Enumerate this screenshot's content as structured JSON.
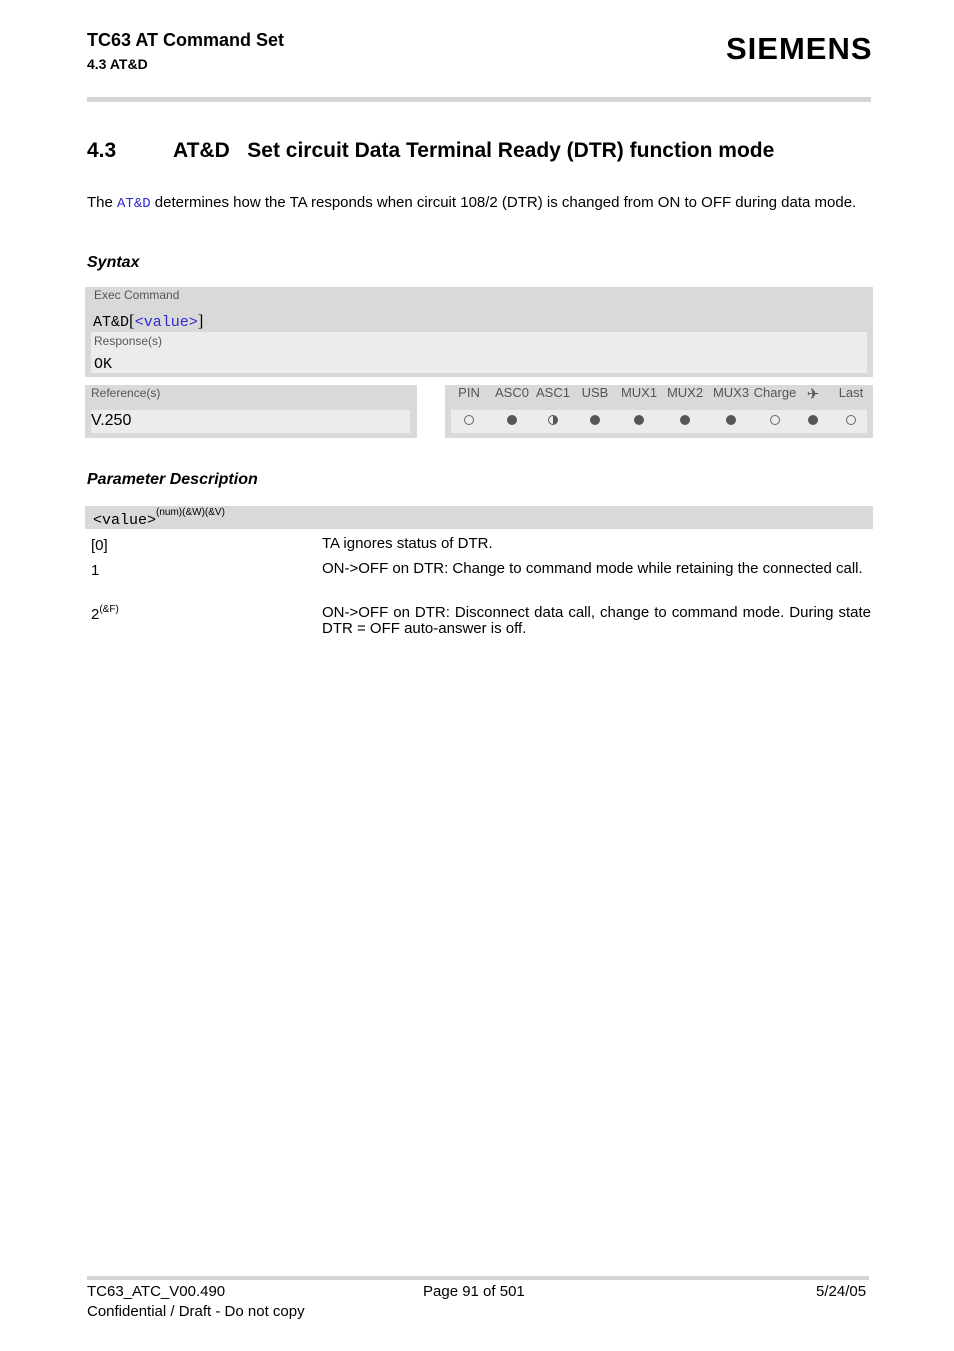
{
  "header": {
    "doc_title": "TC63 AT Command Set",
    "section_ref": "4.3 AT&D",
    "logo": "SIEMENS"
  },
  "section": {
    "number": "4.3",
    "title": "AT&D   Set circuit Data Terminal Ready (DTR) function mode"
  },
  "intro": {
    "pre": "The ",
    "command": "AT&D",
    "post": " determines how the TA responds when circuit 108/2 (DTR) is changed from ON to OFF during data mode."
  },
  "syntax": {
    "heading": "Syntax",
    "exec_label": "Exec Command",
    "exec_cmd": "AT&D",
    "exec_bracket_open": "[",
    "exec_param": "<value>",
    "exec_bracket_close": "]",
    "response_label": "Response(s)",
    "response_value": "OK",
    "reference_label": "Reference(s)",
    "reference_value": "V.250",
    "flags": [
      {
        "label": "PIN",
        "state": "empty"
      },
      {
        "label": "ASC0",
        "state": "full"
      },
      {
        "label": "ASC1",
        "state": "half"
      },
      {
        "label": "USB",
        "state": "full"
      },
      {
        "label": "MUX1",
        "state": "full"
      },
      {
        "label": "MUX2",
        "state": "full"
      },
      {
        "label": "MUX3",
        "state": "full"
      },
      {
        "label": "Charge",
        "state": "empty"
      },
      {
        "label": "✈",
        "state": "full"
      },
      {
        "label": "Last",
        "state": "empty"
      }
    ]
  },
  "parameters": {
    "heading": "Parameter Description",
    "param_name": "<value>",
    "param_attrs": "(num)(&W)(&V)",
    "rows": [
      {
        "key": "[0]",
        "sup": "",
        "desc": "TA ignores status of DTR."
      },
      {
        "key": "1",
        "sup": "",
        "desc": "ON->OFF on DTR: Change to command mode while retaining the connected call."
      },
      {
        "key": "2",
        "sup": "(&F)",
        "desc": "ON->OFF on DTR: Disconnect data call, change to command mode. During state DTR = OFF auto-answer is off."
      }
    ]
  },
  "footer": {
    "doc_id": "TC63_ATC_V00.490",
    "page": "Page 91 of 501",
    "date": "5/24/05",
    "confidential": "Confidential / Draft - Do not copy"
  }
}
